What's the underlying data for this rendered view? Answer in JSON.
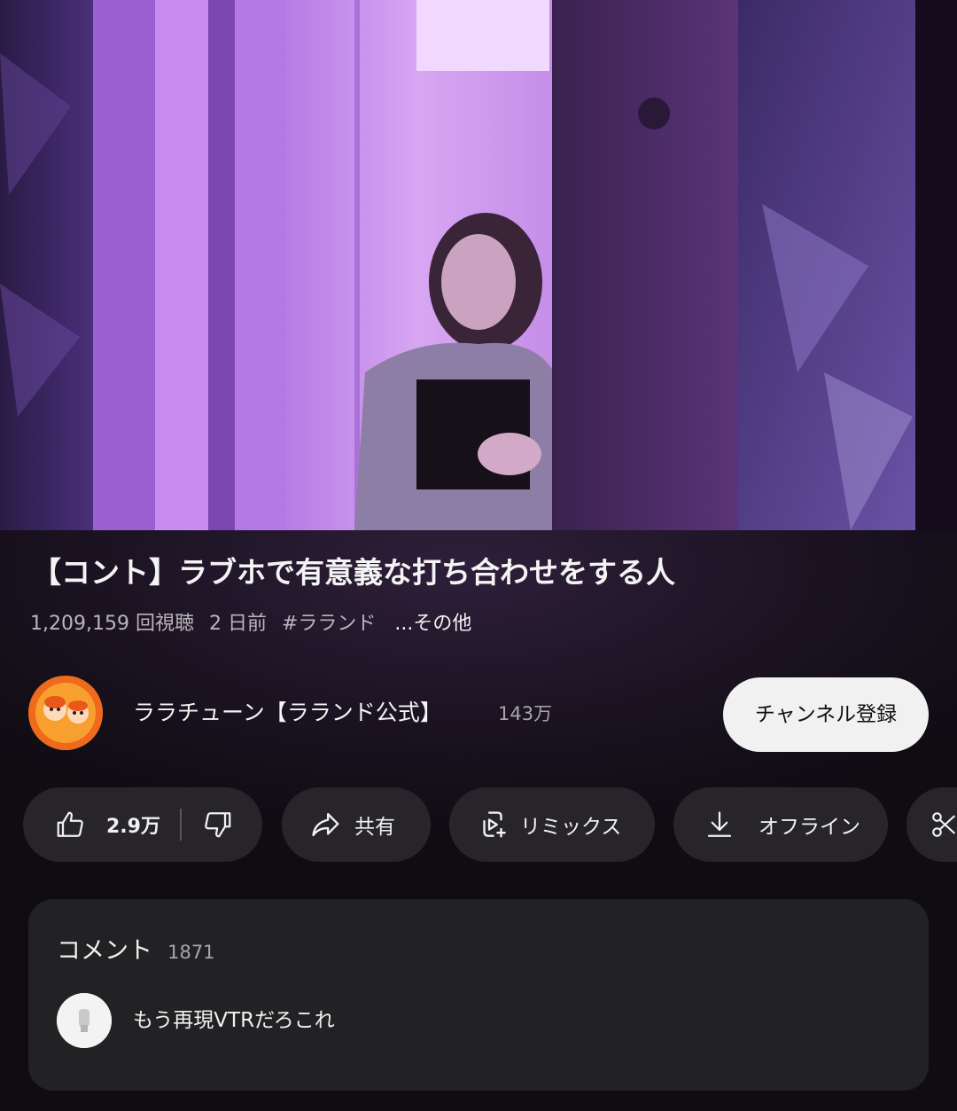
{
  "video": {
    "title": "【コント】ラブホで有意義な打ち合わせをする人",
    "views": "1,209,159 回視聴",
    "published": "2 日前",
    "hashtag": "#ラランド",
    "more": "...その他"
  },
  "channel": {
    "name": "ララチューン【ラランド公式】",
    "subscribers": "143万",
    "subscribe_label": "チャンネル登録"
  },
  "actions": {
    "likes": "2.9万",
    "share_label": "共有",
    "remix_label": "リミックス",
    "offline_label": "オフライン"
  },
  "comments": {
    "label": "コメント",
    "count": "1871",
    "top_comment": "もう再現VTRだろこれ"
  },
  "colors": {
    "background": "#0f0c12",
    "chip": "#272529",
    "card": "#222124",
    "subscribe_bg": "#f1f1f1",
    "accent_purple": "#8a4fc9"
  },
  "icons": [
    "like-icon",
    "dislike-icon",
    "share-icon",
    "remix-icon",
    "download-icon",
    "clip-icon"
  ]
}
